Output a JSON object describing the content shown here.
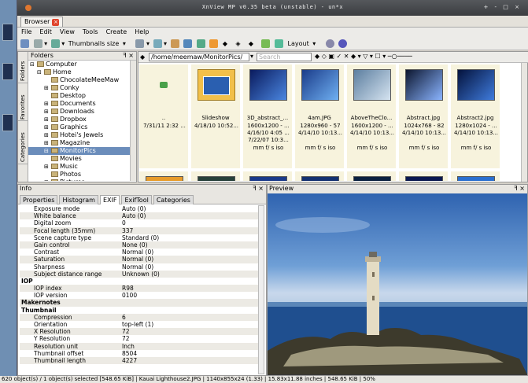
{
  "window": {
    "title": "XnView MP v0.35 beta (unstable) - un*x",
    "controls": "+ - □ ×"
  },
  "browser_tab": {
    "label": "Browser"
  },
  "menu": [
    "File",
    "Edit",
    "View",
    "Tools",
    "Create",
    "Help"
  ],
  "toolbar": {
    "thumbnails_label": "Thumbnails size",
    "layout_label": "Layout"
  },
  "folders": {
    "title": "Folders",
    "side_tabs": [
      "Folders",
      "Favorites",
      "Categories"
    ],
    "tree": [
      {
        "label": "Computer",
        "depth": 0,
        "expander": "⊟"
      },
      {
        "label": "Home",
        "depth": 1,
        "expander": "⊟"
      },
      {
        "label": "ChocolateMeeMaw",
        "depth": 2,
        "expander": ""
      },
      {
        "label": "Conky",
        "depth": 2,
        "expander": "⊞"
      },
      {
        "label": "Desktop",
        "depth": 2,
        "expander": ""
      },
      {
        "label": "Documents",
        "depth": 2,
        "expander": "⊞"
      },
      {
        "label": "Downloads",
        "depth": 2,
        "expander": "⊞"
      },
      {
        "label": "Dropbox",
        "depth": 2,
        "expander": "⊞"
      },
      {
        "label": "Graphics",
        "depth": 2,
        "expander": "⊞"
      },
      {
        "label": "Hotei's Jewels",
        "depth": 2,
        "expander": "⊞"
      },
      {
        "label": "Magazine",
        "depth": 2,
        "expander": "⊞"
      },
      {
        "label": "MonitorPics",
        "depth": 2,
        "expander": "⊟",
        "selected": true
      },
      {
        "label": "Movies",
        "depth": 2,
        "expander": ""
      },
      {
        "label": "Music",
        "depth": 2,
        "expander": "⊞"
      },
      {
        "label": "Photos",
        "depth": 2,
        "expander": ""
      },
      {
        "label": "Pictures",
        "depth": 2,
        "expander": "⊞"
      }
    ]
  },
  "address": {
    "path": "/home/meemaw/MonitorPics/",
    "search_placeholder": "Search"
  },
  "thumbs": [
    {
      "name": "..",
      "l1": "7/31/11 2:32 ...",
      "l2": "",
      "l3": "",
      "l4": "",
      "kind": "up"
    },
    {
      "name": "Slideshow",
      "l1": "4/18/10 10:52...",
      "l2": "",
      "l3": "",
      "l4": "",
      "kind": "folder"
    },
    {
      "name": "3D_abstract_...",
      "l1": "1600x1200 - ...",
      "l2": "4/16/10 4:05 ...",
      "l3": "7/22/07 10:3...",
      "l4": "mm f/ s iso",
      "kind": "img",
      "c1": "#0a1b5e",
      "c2": "#4a86e0"
    },
    {
      "name": "4am.JPG",
      "l1": "1280x960 - 57",
      "l2": "4/14/10 10:13...",
      "l3": "",
      "l4": "mm f/ s iso",
      "kind": "img",
      "c1": "#1b3c8a",
      "c2": "#6fb0f2"
    },
    {
      "name": "AboveTheClo...",
      "l1": "1600x1200 - ...",
      "l2": "4/14/10 10:13...",
      "l3": "",
      "l4": "mm f/ s iso",
      "kind": "img",
      "c1": "#5d7fa0",
      "c2": "#d5e3f0"
    },
    {
      "name": "Abstract.jpg",
      "l1": "1024x768 - 82",
      "l2": "4/14/10 10:13...",
      "l3": "",
      "l4": "mm f/ s iso",
      "kind": "img",
      "c1": "#0d1730",
      "c2": "#8ab4ff"
    },
    {
      "name": "Abstract2.jpg",
      "l1": "1280x1024 - ...",
      "l2": "4/14/10 10:13...",
      "l3": "",
      "l4": "mm f/ s iso",
      "kind": "img",
      "c1": "#04133d",
      "c2": "#3f7bdc"
    }
  ],
  "info": {
    "title": "Info",
    "tabs": [
      "Properties",
      "Histogram",
      "EXIF",
      "ExifTool",
      "Categories"
    ],
    "active_tab": "EXIF",
    "rows": [
      {
        "k": "Exposure mode",
        "v": "Auto (0)"
      },
      {
        "k": "White balance",
        "v": "Auto (0)"
      },
      {
        "k": "Digital zoom",
        "v": "0"
      },
      {
        "k": "Focal length (35mm)",
        "v": "337"
      },
      {
        "k": "Scene capture type",
        "v": "Standard (0)"
      },
      {
        "k": "Gain control",
        "v": "None (0)"
      },
      {
        "k": "Contrast",
        "v": "Normal (0)"
      },
      {
        "k": "Saturation",
        "v": "Normal (0)"
      },
      {
        "k": "Sharpness",
        "v": "Normal (0)"
      },
      {
        "k": "Subject distance range",
        "v": "Unknown (0)"
      },
      {
        "k": "IOP",
        "v": "",
        "group": true
      },
      {
        "k": "IOP index",
        "v": "R98"
      },
      {
        "k": "IOP version",
        "v": "0100"
      },
      {
        "k": "Makernotes",
        "v": "",
        "group": true
      },
      {
        "k": "Thumbnail",
        "v": "",
        "group": true
      },
      {
        "k": "Compression",
        "v": "6"
      },
      {
        "k": "Orientation",
        "v": "top-left (1)"
      },
      {
        "k": "X Resolution",
        "v": "72"
      },
      {
        "k": "Y Resolution",
        "v": "72"
      },
      {
        "k": "Resolution unit",
        "v": "Inch"
      },
      {
        "k": "Thumbnail offset",
        "v": "8504"
      },
      {
        "k": "Thumbnail length",
        "v": "4227"
      }
    ]
  },
  "preview": {
    "title": "Preview"
  },
  "status": "620 object(s) / 1 object(s) selected [548.65 KiB] | Kauai Lighthouse2.JPG | 1140x855x24 (1.33) | 15.83x11.88 inches | 548.65 KiB | 50%",
  "colors": {
    "selection": "#6b8dbb",
    "thumb_bg": "#f7f3dd",
    "titlebar": "#3b3d40"
  }
}
